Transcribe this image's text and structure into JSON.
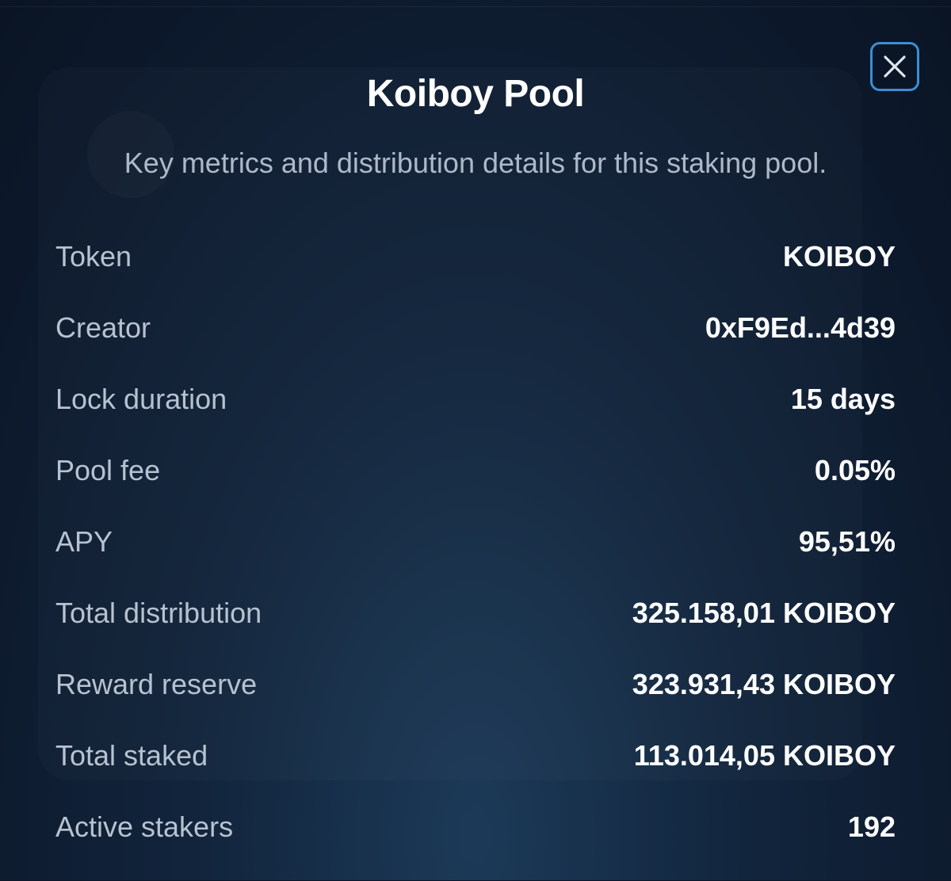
{
  "modal": {
    "title": "Koiboy Pool",
    "subtitle": "Key metrics and distribution details for this staking pool.",
    "close_icon": "close-icon",
    "rows": [
      {
        "label": "Token",
        "value": "KOIBOY"
      },
      {
        "label": "Creator",
        "value": "0xF9Ed...4d39"
      },
      {
        "label": "Lock duration",
        "value": "15 days"
      },
      {
        "label": "Pool fee",
        "value": "0.05%"
      },
      {
        "label": "APY",
        "value": "95,51%"
      },
      {
        "label": "Total distribution",
        "value": "325.158,01 KOIBOY"
      },
      {
        "label": "Reward reserve",
        "value": "323.931,43 KOIBOY"
      },
      {
        "label": "Total staked",
        "value": "113.014,05 KOIBOY"
      },
      {
        "label": "Active stakers",
        "value": "192"
      }
    ]
  },
  "colors": {
    "accent": "#3b8fd4",
    "background": "#0d1a2d",
    "label": "#b7c2d0",
    "value": "#ffffff"
  }
}
